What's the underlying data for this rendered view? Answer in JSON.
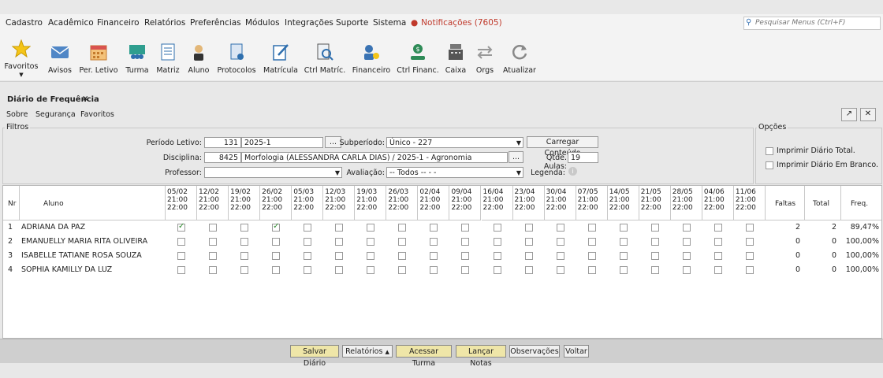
{
  "menu": {
    "items": [
      {
        "label": "Cadastro",
        "id": "cadastro"
      },
      {
        "label": "Acadêmico",
        "id": "academico"
      },
      {
        "label": "Financeiro",
        "id": "financeiro"
      },
      {
        "label": "Relatórios",
        "id": "relatorios"
      },
      {
        "label": "Preferências",
        "id": "preferencias"
      },
      {
        "label": "Módulos",
        "id": "modulos"
      },
      {
        "label": "Integrações",
        "id": "integracoes"
      },
      {
        "label": "Suporte",
        "id": "suporte"
      },
      {
        "label": "Sistema",
        "id": "sistema"
      }
    ],
    "notifications": "Notificações (7605)",
    "search_placeholder": "Pesquisar Menus (Ctrl+F)"
  },
  "toolbar": {
    "favoritos": "Favoritos",
    "avisos": "Avisos",
    "per_letivo": "Per. Letivo",
    "turma": "Turma",
    "matriz": "Matriz",
    "aluno": "Aluno",
    "protocolos": "Protocolos",
    "matricula": "Matrícula",
    "ctrl_matric": "Ctrl Matríc.",
    "financeiro": "Financeiro",
    "ctrl_financ": "Ctrl Financ.",
    "caixa": "Caixa",
    "orgs": "Orgs",
    "atualizar": "Atualizar"
  },
  "tab": {
    "title": "Diário de Frequência",
    "close": "×"
  },
  "submenu": {
    "sobre": "Sobre",
    "seguranca": "Segurança",
    "favoritos": "Favoritos"
  },
  "filtros": {
    "title": "Filtros",
    "periodo_label": "Período Letivo:",
    "periodo_code": "131",
    "periodo_value": "2025-1",
    "subperiodo_label": "Subperíodo:",
    "subperiodo_value": "Único - 227",
    "carregar": "Carregar Conteúdo",
    "disciplina_label": "Disciplina:",
    "disciplina_code": "8425",
    "disciplina_value": "Morfologia  (ALESSANDRA CARLA DIAS) / 2025-1 - Agronomia",
    "qtde_label": "Qtde. Aulas:",
    "qtde_value": "19",
    "professor_label": "Professor:",
    "professor_value": "",
    "avaliacao_label": "Avaliação:",
    "avaliacao_value": "-- Todos -- -  -",
    "legenda_label": "Legenda:",
    "ellipsis": "..."
  },
  "opcoes": {
    "title": "Opções",
    "imprimir_total": "Imprimir Diário Total.",
    "imprimir_branco": "Imprimir Diário Em Branco."
  },
  "grid": {
    "headers": {
      "nr": "Nr",
      "aluno": "Aluno",
      "faltas": "Faltas",
      "total": "Total",
      "freq": "Freq."
    },
    "dates": [
      {
        "date": "05/02",
        "start": "21:00",
        "end": "22:00"
      },
      {
        "date": "12/02",
        "start": "21:00",
        "end": "22:00"
      },
      {
        "date": "19/02",
        "start": "21:00",
        "end": "22:00"
      },
      {
        "date": "26/02",
        "start": "21:00",
        "end": "22:00"
      },
      {
        "date": "05/03",
        "start": "21:00",
        "end": "22:00"
      },
      {
        "date": "12/03",
        "start": "21:00",
        "end": "22:00"
      },
      {
        "date": "19/03",
        "start": "21:00",
        "end": "22:00"
      },
      {
        "date": "26/03",
        "start": "21:00",
        "end": "22:00"
      },
      {
        "date": "02/04",
        "start": "21:00",
        "end": "22:00"
      },
      {
        "date": "09/04",
        "start": "21:00",
        "end": "22:00"
      },
      {
        "date": "16/04",
        "start": "21:00",
        "end": "22:00"
      },
      {
        "date": "23/04",
        "start": "21:00",
        "end": "22:00"
      },
      {
        "date": "30/04",
        "start": "21:00",
        "end": "22:00"
      },
      {
        "date": "07/05",
        "start": "21:00",
        "end": "22:00"
      },
      {
        "date": "14/05",
        "start": "21:00",
        "end": "22:00"
      },
      {
        "date": "21/05",
        "start": "21:00",
        "end": "22:00"
      },
      {
        "date": "28/05",
        "start": "21:00",
        "end": "22:00"
      },
      {
        "date": "04/06",
        "start": "21:00",
        "end": "22:00"
      },
      {
        "date": "11/06",
        "start": "21:00",
        "end": "22:00"
      }
    ],
    "rows": [
      {
        "nr": "1",
        "aluno": "ADRIANA DA PAZ",
        "checks": [
          true,
          false,
          false,
          true,
          false,
          false,
          false,
          false,
          false,
          false,
          false,
          false,
          false,
          false,
          false,
          false,
          false,
          false,
          false
        ],
        "faltas": "2",
        "total": "2",
        "freq": "89,47%"
      },
      {
        "nr": "2",
        "aluno": "EMANUELLY MARIA RITA OLIVEIRA",
        "checks": [
          false,
          false,
          false,
          false,
          false,
          false,
          false,
          false,
          false,
          false,
          false,
          false,
          false,
          false,
          false,
          false,
          false,
          false,
          false
        ],
        "faltas": "0",
        "total": "0",
        "freq": "100,00%"
      },
      {
        "nr": "3",
        "aluno": "ISABELLE TATIANE ROSA SOUZA",
        "checks": [
          false,
          false,
          false,
          false,
          false,
          false,
          false,
          false,
          false,
          false,
          false,
          false,
          false,
          false,
          false,
          false,
          false,
          false,
          false
        ],
        "faltas": "0",
        "total": "0",
        "freq": "100,00%"
      },
      {
        "nr": "4",
        "aluno": "SOPHIA KAMILLY DA LUZ",
        "checks": [
          false,
          false,
          false,
          false,
          false,
          false,
          false,
          false,
          false,
          false,
          false,
          false,
          false,
          false,
          false,
          false,
          false,
          false,
          false
        ],
        "faltas": "0",
        "total": "0",
        "freq": "100,00%"
      }
    ]
  },
  "actions": {
    "salvar": "Salvar Diário",
    "relatorios": "Relatórios",
    "acessar": "Acessar Turma",
    "lancar": "Lançar Notas",
    "observacoes": "Observações",
    "voltar": "Voltar"
  },
  "colors": {
    "accent": "#efe6a8",
    "notif": "#c0392b",
    "check": "#2e8b2e"
  }
}
